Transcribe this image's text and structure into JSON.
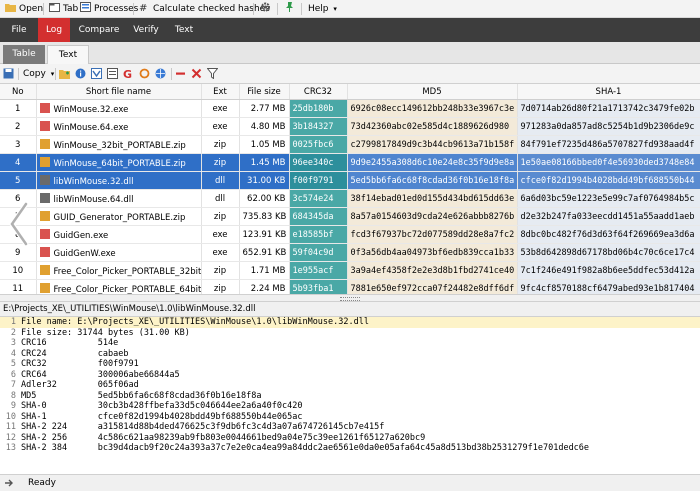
{
  "toolbar": {
    "open": "Open",
    "tab": "Tab",
    "processes": "Processes",
    "calculate": "Calculate checked hashes",
    "help": "Help"
  },
  "menu": [
    "File",
    "Log",
    "Compare",
    "Verify",
    "Text"
  ],
  "view_tabs": [
    "Table",
    "Text"
  ],
  "toolstrip": {
    "copy": "Copy"
  },
  "grid": {
    "columns": [
      "No",
      "Short file name",
      "Ext",
      "File size",
      "CRC32",
      "MD5",
      "SHA-1"
    ],
    "rows": [
      [
        "1",
        "WinMouse.32.exe",
        "exe",
        "2.77 MB",
        "25db180b",
        "6926c08ecc149612bb248b33e3967c3e",
        "7d0714ab26d80f21a1713742c3479fe02b"
      ],
      [
        "2",
        "WinMouse.64.exe",
        "exe",
        "4.80 MB",
        "3b184327",
        "73d42360abc02e585d4c1889626d980",
        "971283a0da857ad8c5254b1d9b2306de9c"
      ],
      [
        "3",
        "WinMouse_32bit_PORTABLE.zip",
        "zip",
        "1.05 MB",
        "0025fbc6",
        "c2799817849d9c3b44cb9613a71b158f",
        "84f791ef7235d486a5707827fd938aad4f"
      ],
      [
        "4",
        "WinMouse_64bit_PORTABLE.zip",
        "zip",
        "1.45 MB",
        "96ee340c",
        "9d9e2455a308d6c10e24e8c35f9d9e8a",
        "1e50ae08166bbed0f4e56930ded3748e84"
      ],
      [
        "5",
        "libWinMouse.32.dll",
        "dll",
        "31.00 KB",
        "f00f9791",
        "5ed5bb6fa6c68f8cdad36f0b16e18f8a",
        "cfce0f82d1994b4028bdd49bf688550b44"
      ],
      [
        "6",
        "libWinMouse.64.dll",
        "dll",
        "62.00 KB",
        "3c574e24",
        "38f14ebad01ed0d155d434bd615dd63e",
        "6a6d03bc59e1223e5e99c7af0764984b5c"
      ],
      [
        "7",
        "GUID_Generator_PORTABLE.zip",
        "zip",
        "735.83 KB",
        "684345da",
        "8a57a0154603d9cda24e626abbb8276b",
        "d2e32b247fa033eecdd1451a55aadd1aeb"
      ],
      [
        "8",
        "GuidGen.exe",
        "exe",
        "123.91 KB",
        "e18585bf",
        "fcd3f67937bc72d077589dd28e8a7fc2",
        "8dbc0bc482f76d3d63f64f269669ea3d6a"
      ],
      [
        "9",
        "GuidGenW.exe",
        "exe",
        "652.91 KB",
        "59f04c9d",
        "0f3a56db4aa04973bf6edb839cca1b33",
        "53b8d642898d67178bd06b4c70c6ce17c4"
      ],
      [
        "10",
        "Free_Color_Picker_PORTABLE_32bit.zip",
        "zip",
        "1.71 MB",
        "1e955acf",
        "3a9a4ef4358f2e2e3d8b1fbd2741ce40",
        "7c1f246e491f982a8b6ee5ddfec53d412a"
      ],
      [
        "11",
        "Free_Color_Picker_PORTABLE_64bit.zip",
        "zip",
        "2.24 MB",
        "5b93fba1",
        "7881e650ef972cca07f24482e8dff6df",
        "9fc4cf8570188cf6479abed93e1b817404"
      ],
      [
        "12",
        "FreeColorPicker.32.exe",
        "exe",
        "4.79 MB",
        "2fbbd6bc",
        "86c5c6d75950665df86d619e2323e3a",
        "e3c351030d251b9c3a8679e0673904db4f"
      ]
    ],
    "selected_rows": [
      4,
      5
    ]
  },
  "path": "E:\\Projects_XE\\_UTILITIES\\WinMouse\\1.0\\libWinMouse.32.dll",
  "text_lines": [
    [
      "1",
      "File name: E:\\Projects_XE\\_UTILITIES\\WinMouse\\1.0\\libWinMouse.32.dll"
    ],
    [
      "2",
      "File size: 31744 bytes (31.00 KB)"
    ],
    [
      "3",
      "CRC16          514e"
    ],
    [
      "4",
      "CRC24          cabaeb"
    ],
    [
      "5",
      "CRC32          f00f9791"
    ],
    [
      "6",
      "CRC64          300006abe66844a5"
    ],
    [
      "7",
      "Adler32        065f06ad"
    ],
    [
      "8",
      "MD5            5ed5bb6fa6c68f8cdad36f0b16e18f8a"
    ],
    [
      "9",
      "SHA-0          30cb3b428ffbefa33d5c046644ee2a6a40f0c420"
    ],
    [
      "10",
      "SHA-1          cfce0f82d1994b4028bdd49bf688550b44e065ac"
    ],
    [
      "11",
      "SHA-2 224      a315814d88b4ded476625c3f9db6fc3c4d3a07a674726145cb7e415f"
    ],
    [
      "12",
      "SHA-2 256      4c586c621aa98239ab9fb803e0044661bed9a04e75c39ee1261f65127a620bc9"
    ],
    [
      "13",
      "SHA-2 384      bc39d4dacb9f20c24a393a37c7e2e0ca4ea99a84ddc2ae6561e0da0e05afa64c45a8d513bd38b2531279f1e701dedc6e"
    ]
  ],
  "status": "Ready",
  "colors": {
    "accent": "#d32f2f",
    "menubar": "#3d3d3d",
    "crc": "#4aa8a6",
    "md5": "#f3ead9",
    "sha": "#e6ebf2",
    "selection": "#2f6fc7"
  }
}
